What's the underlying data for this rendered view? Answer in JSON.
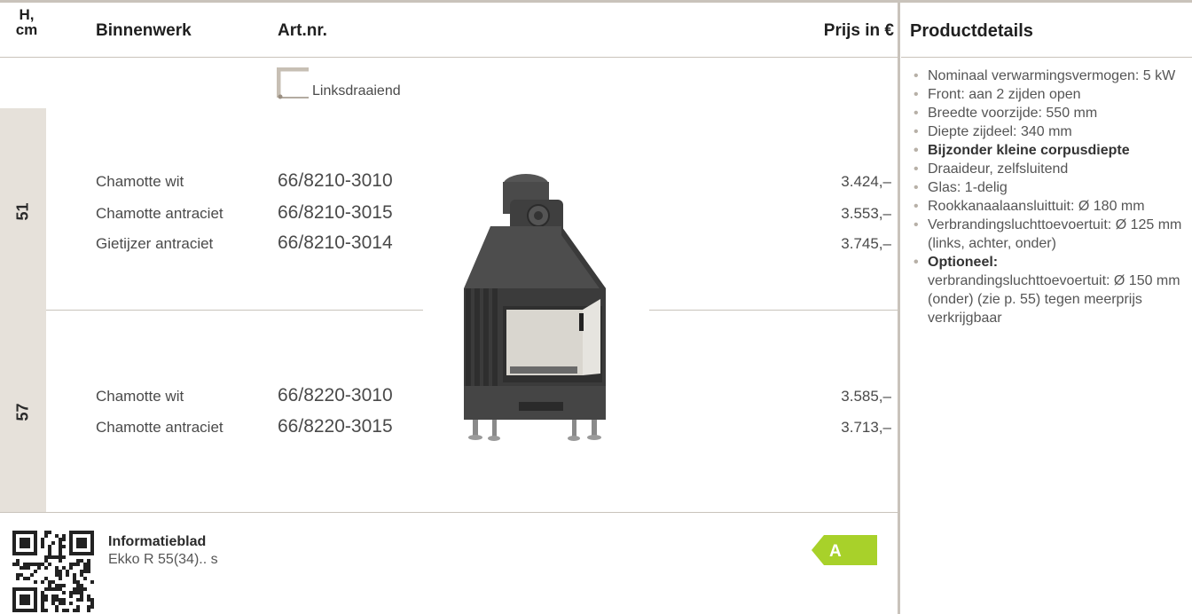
{
  "header": {
    "height": "H,",
    "height_unit": "cm",
    "binnenwerk": "Binnenwerk",
    "artnr": "Art.nr.",
    "prijs": "Prijs in €",
    "productdetails": "Productdetails"
  },
  "orientation": {
    "label": "Linksdraaiend",
    "icon": "corner-bracket-icon"
  },
  "groups": [
    {
      "height": "51",
      "rows": [
        {
          "binnenwerk": "Chamotte wit",
          "artnr": "66/8210-3010",
          "price": "3.424,–"
        },
        {
          "binnenwerk": "Chamotte antraciet",
          "artnr": "66/8210-3015",
          "price": "3.553,–"
        },
        {
          "binnenwerk": "Gietijzer antraciet",
          "artnr": "66/8210-3014",
          "price": "3.745,–"
        }
      ]
    },
    {
      "height": "57",
      "rows": [
        {
          "binnenwerk": "Chamotte wit",
          "artnr": "66/8220-3010",
          "price": "3.585,–"
        },
        {
          "binnenwerk": "Chamotte antraciet",
          "artnr": "66/8220-3015",
          "price": "3.713,–"
        }
      ]
    }
  ],
  "details": [
    {
      "text": "Nominaal verwarmingsvermogen: 5 kW"
    },
    {
      "text": "Front: aan 2 zijden open"
    },
    {
      "text": "Breedte voorzijde: 550 mm"
    },
    {
      "text": "Diepte zijdeel: 340 mm"
    },
    {
      "text": "Bijzonder kleine corpusdiepte"
    },
    {
      "text": "Draaideur, zelfsluitend"
    },
    {
      "text": "Glas: 1-delig"
    },
    {
      "text": "Rookkanaalaansluittuit: Ø 180 mm"
    },
    {
      "text": "Verbrandingsluchttoevoertuit: Ø 125 mm (links, achter, onder)"
    },
    {
      "title": "Optioneel:",
      "text": "verbrandingsluchttoevoertuit: Ø 150 mm (onder) (zie p. 55) tegen meerprijs verkrijgbaar"
    }
  ],
  "footer": {
    "info_title": "Informatieblad",
    "info_sub": "Ekko R 55(34).. s",
    "energy_class": "A",
    "qr_icon": "qr-code-icon"
  },
  "colors": {
    "rule": "#c9c3bb",
    "height_column": "#e6e1da",
    "energy_green": "#a8d12a"
  }
}
